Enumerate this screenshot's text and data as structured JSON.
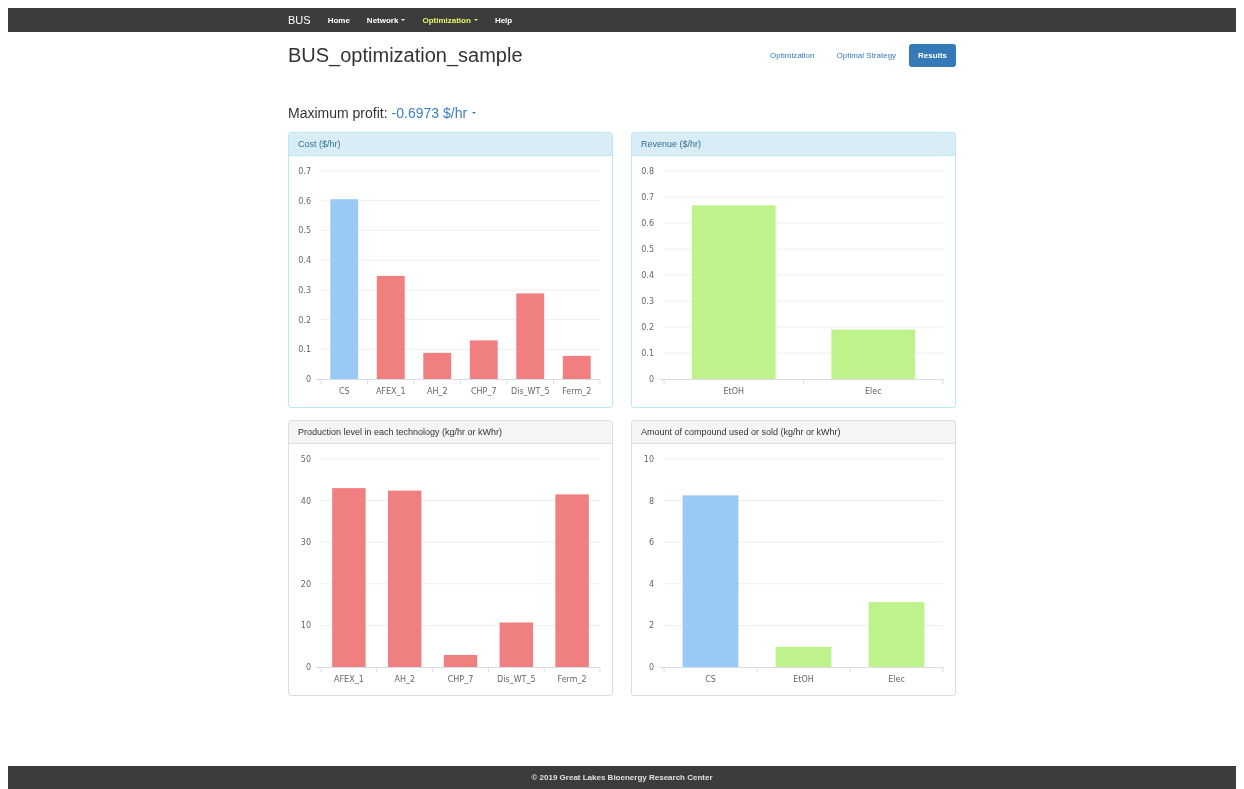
{
  "navbar": {
    "brand": "BUS",
    "items": [
      {
        "label": "Home",
        "dropdown": false,
        "selected": false
      },
      {
        "label": "Network",
        "dropdown": true,
        "selected": false
      },
      {
        "label": "Optimization",
        "dropdown": true,
        "selected": true
      },
      {
        "label": "Help",
        "dropdown": false,
        "selected": false
      }
    ]
  },
  "page_title": "BUS_optimization_sample",
  "view_tabs": [
    {
      "label": "Optimization",
      "selected": false
    },
    {
      "label": "Optimal Strategy",
      "selected": false
    },
    {
      "label": "Results",
      "selected": true
    }
  ],
  "profit": {
    "label": "Maximum profit:",
    "value": "-0.6973 $/hr"
  },
  "panels": [
    {
      "title": "Cost ($/hr)",
      "chart_data": {
        "type": "bar",
        "grid": true,
        "categories": [
          "CS",
          "AFEX_1",
          "AH_2",
          "CHP_7",
          "Dis_WT_5",
          "Ferm_2"
        ],
        "series": [
          {
            "color": "#99c9f5",
            "values": [
              0.605,
              null,
              null,
              null,
              null,
              null
            ]
          },
          {
            "color": "#f08080",
            "values": [
              null,
              0.347,
              0.088,
              0.13,
              0.288,
              0.078
            ]
          }
        ],
        "ylim": [
          0,
          0.7
        ],
        "yticks": [
          0,
          0.1,
          0.2,
          0.3,
          0.4,
          0.5,
          0.6,
          0.7
        ]
      }
    },
    {
      "title": "Revenue ($/hr)",
      "chart_data": {
        "type": "bar",
        "grid": true,
        "categories": [
          "EtOH",
          "Elec"
        ],
        "series": [
          {
            "color": "#bdf38a",
            "values": [
              0.668,
              0.19
            ]
          }
        ],
        "ylim": [
          0,
          0.8
        ],
        "yticks": [
          0,
          0.1,
          0.2,
          0.3,
          0.4,
          0.5,
          0.6,
          0.7,
          0.8
        ]
      }
    },
    {
      "title": "Production level in each technology (kg/hr or kWhr)",
      "chart_data": {
        "type": "bar",
        "grid": true,
        "categories": [
          "AFEX_1",
          "AH_2",
          "CHP_7",
          "Dis_WT_5",
          "Ferm_2"
        ],
        "series": [
          {
            "color": "#f08080",
            "values": [
              43.0,
              42.4,
              2.9,
              10.7,
              41.5
            ]
          }
        ],
        "ylim": [
          0,
          50
        ],
        "yticks": [
          0,
          10,
          20,
          30,
          40,
          50
        ]
      }
    },
    {
      "title": "Amount of compound used or sold (kg/hr or kWhr)",
      "chart_data": {
        "type": "bar",
        "grid": true,
        "categories": [
          "CS",
          "EtOH",
          "Elec"
        ],
        "series": [
          {
            "color": "#99c9f5",
            "values": [
              8.25,
              null,
              null
            ]
          },
          {
            "color": "#bdf38a",
            "values": [
              null,
              0.97,
              3.12
            ]
          }
        ],
        "ylim": [
          0,
          10
        ],
        "yticks": [
          0,
          2,
          4,
          6,
          8,
          10
        ]
      }
    }
  ],
  "footer": "© 2019 Great Lakes Bioenergy Research Center"
}
